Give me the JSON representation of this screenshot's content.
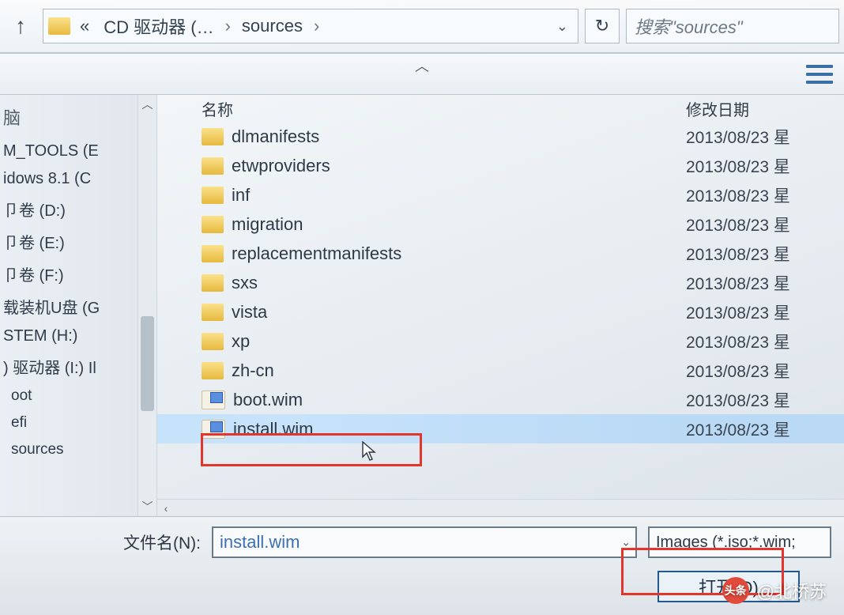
{
  "toolbar": {
    "breadcrumb_prefix": "«",
    "crumb_drive": "CD 驱动器 (…",
    "crumb_folder": "sources",
    "refresh_glyph": "↻",
    "search_placeholder": "搜索\"sources\""
  },
  "columns": {
    "name": "名称",
    "modified": "修改日期"
  },
  "nav": {
    "header": "脑",
    "items": [
      {
        "label": "M_TOOLS (E"
      },
      {
        "label": "idows 8.1 (C"
      },
      {
        "label": "卩卷 (D:)"
      },
      {
        "label": "卩卷 (E:)"
      },
      {
        "label": "卩卷 (F:)"
      },
      {
        "label": "载装机U盘 (G"
      },
      {
        "label": "STEM (H:)"
      },
      {
        "label": ") 驱动器 (I:) Il"
      },
      {
        "label": "oot",
        "child": true
      },
      {
        "label": "efi",
        "child": true
      },
      {
        "label": "sources",
        "child": true
      }
    ]
  },
  "files": [
    {
      "name": "dlmanifests",
      "date": "2013/08/23 星",
      "type": "folder"
    },
    {
      "name": "etwproviders",
      "date": "2013/08/23 星",
      "type": "folder"
    },
    {
      "name": "inf",
      "date": "2013/08/23 星",
      "type": "folder"
    },
    {
      "name": "migration",
      "date": "2013/08/23 星",
      "type": "folder"
    },
    {
      "name": "replacementmanifests",
      "date": "2013/08/23 星",
      "type": "folder"
    },
    {
      "name": "sxs",
      "date": "2013/08/23 星",
      "type": "folder"
    },
    {
      "name": "vista",
      "date": "2013/08/23 星",
      "type": "folder"
    },
    {
      "name": "xp",
      "date": "2013/08/23 星",
      "type": "folder"
    },
    {
      "name": "zh-cn",
      "date": "2013/08/23 星",
      "type": "folder"
    },
    {
      "name": "boot.wim",
      "date": "2013/08/23 星",
      "type": "wim"
    },
    {
      "name": "install.wim",
      "date": "2013/08/23 星",
      "type": "wim",
      "selected": true
    }
  ],
  "footer": {
    "filename_label": "文件名(N):",
    "filename_value": "install.wim",
    "filter_label": "Images (*.iso;*.wim;",
    "open_label": "打开(O)"
  },
  "watermark": {
    "badge": "头条",
    "text": "@北桥苏"
  }
}
